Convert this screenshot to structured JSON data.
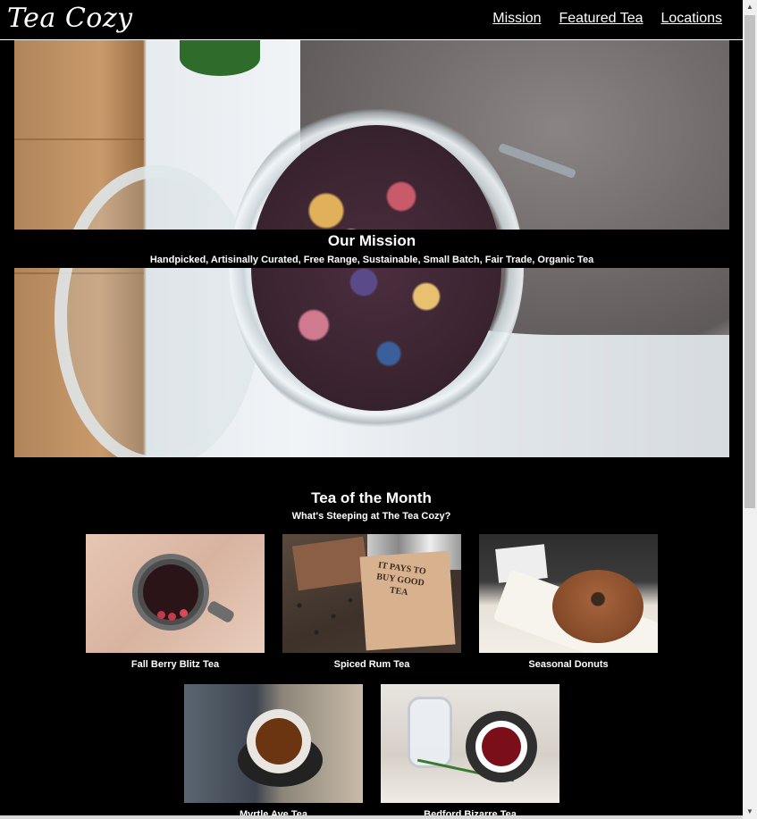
{
  "header": {
    "logo": "Tea Cozy",
    "nav": [
      "Mission",
      "Featured Tea",
      "Locations"
    ]
  },
  "mission": {
    "title": "Our Mission",
    "subtitle": "Handpicked, Artisinally Curated, Free Range, Sustainable, Small Batch, Fair Trade, Organic Tea"
  },
  "featured": {
    "title": "Tea of the Month",
    "subtitle": "What's Steeping at The Tea Cozy?",
    "items": [
      {
        "caption": "Fall Berry Blitz Tea"
      },
      {
        "caption": "Spiced Rum Tea"
      },
      {
        "caption": "Seasonal Donuts"
      },
      {
        "caption": "Myrtle Ave Tea"
      },
      {
        "caption": "Bedford Bizarre Tea"
      }
    ],
    "box_text": "IT PAYS TO BUY GOOD TEA"
  },
  "colors": {
    "background": "#000000",
    "text": "#ffffff"
  }
}
